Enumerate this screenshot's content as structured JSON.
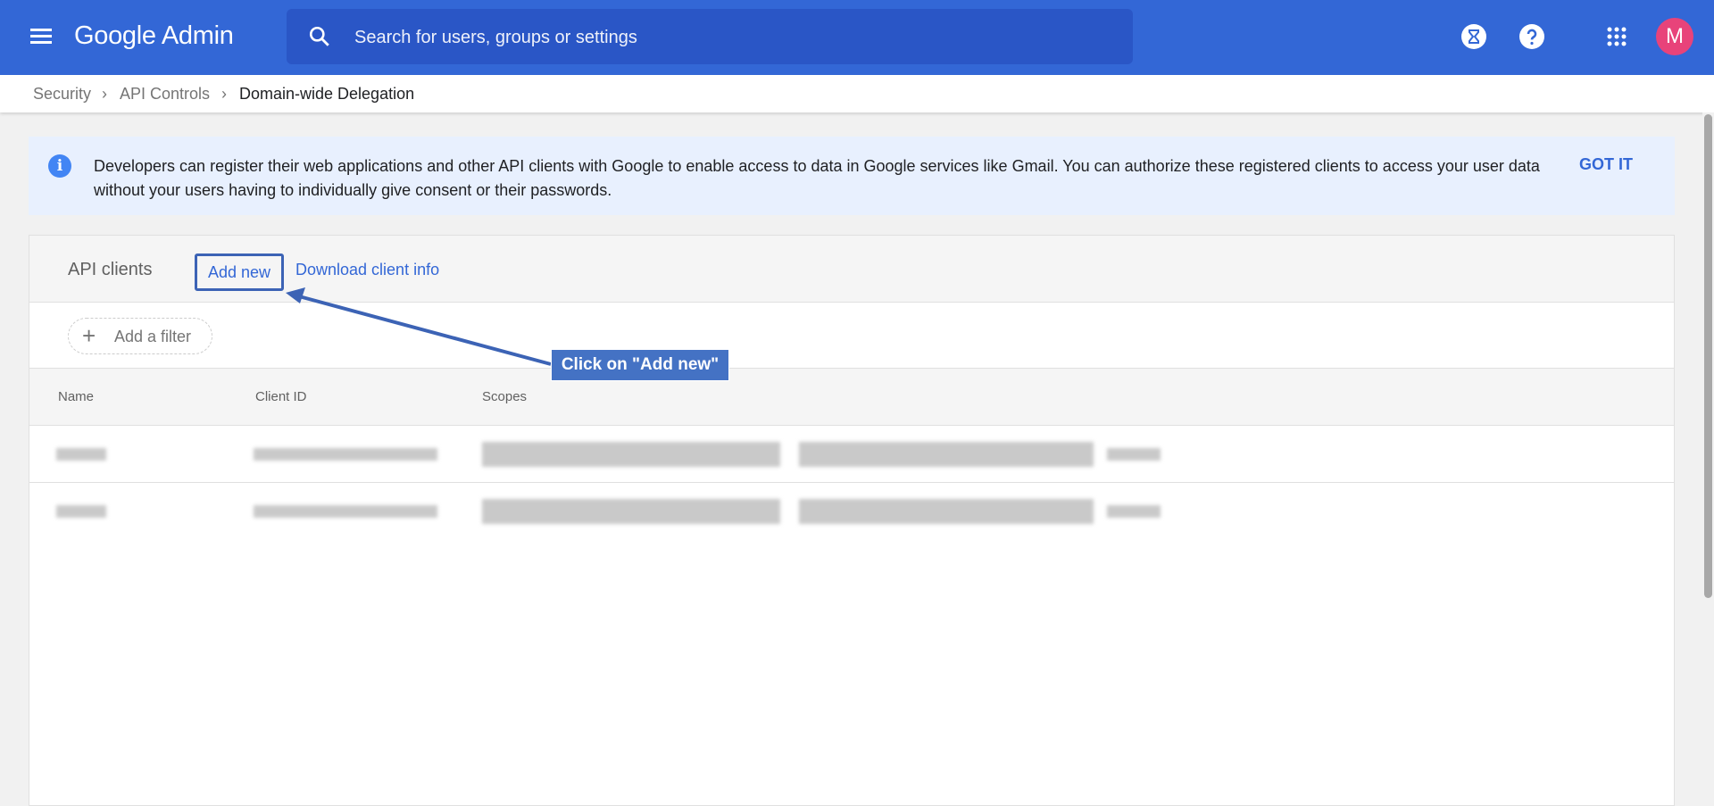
{
  "header": {
    "app_title": "Google Admin",
    "search_placeholder": "Search for users, groups or settings",
    "avatar_initial": "M"
  },
  "breadcrumb": [
    "Security",
    "API Controls",
    "Domain-wide Delegation"
  ],
  "banner": {
    "text": "Developers can register their web applications and other API clients with Google to enable access to data in Google services like Gmail. You can authorize these registered clients to access your user data without your users having to individually give consent or their passwords.",
    "action": "GOT IT"
  },
  "card": {
    "title": "API clients",
    "add_new": "Add new",
    "download": "Download client info",
    "filter": "Add a filter"
  },
  "table": {
    "columns": [
      "Name",
      "Client ID",
      "Scopes"
    ]
  },
  "annotation": {
    "callout": "Click on \"Add new\""
  },
  "colors": {
    "header": "#3367d6",
    "accent": "#3367d6",
    "callout": "#4472c4",
    "avatar": "#e8437a"
  }
}
